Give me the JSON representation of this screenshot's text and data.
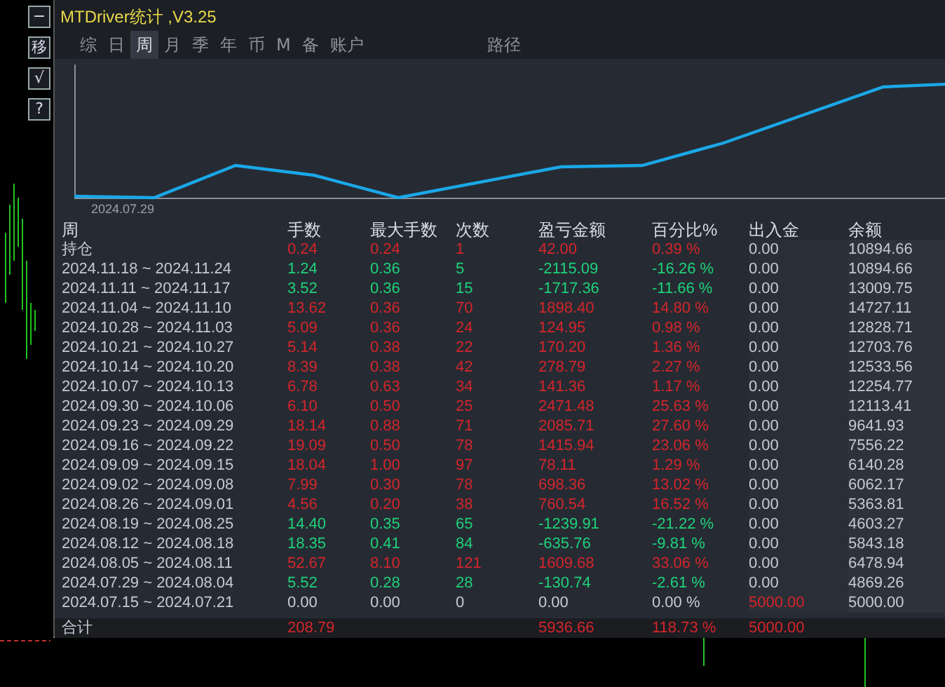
{
  "toolbar": [
    "−",
    "移",
    "√",
    "?"
  ],
  "window": {
    "title": "MTDriver统计 ,V3.25"
  },
  "tabs": [
    {
      "label": "综",
      "selected": false
    },
    {
      "label": "日",
      "selected": false
    },
    {
      "label": "周",
      "selected": true
    },
    {
      "label": "月",
      "selected": false
    },
    {
      "label": "季",
      "selected": false
    },
    {
      "label": "年",
      "selected": false
    },
    {
      "label": "币",
      "selected": false
    },
    {
      "label": "M",
      "selected": false
    },
    {
      "label": "备",
      "selected": false
    },
    {
      "label": "账户",
      "selected": false
    },
    {
      "label": "路径",
      "selected": false
    }
  ],
  "chart": {
    "start_label": "2024.07.29"
  },
  "table": {
    "columns": [
      "周",
      "手数",
      "最大手数",
      "次数",
      "盈亏金额",
      "百分比%",
      "出入金",
      "余额"
    ],
    "rows": [
      {
        "period": "持仓",
        "lots": "0.24",
        "max_lots": "0.24",
        "trades": "1",
        "pnl": "42.00",
        "percent": "0.39 %",
        "deposit": "0.00",
        "balance": "10894.66",
        "kind": "gain",
        "deposit_highlight": false
      },
      {
        "period": "2024.11.18 ~ 2024.11.24",
        "lots": "1.24",
        "max_lots": "0.36",
        "trades": "5",
        "pnl": "-2115.09",
        "percent": "-16.26 %",
        "deposit": "0.00",
        "balance": "10894.66",
        "kind": "loss",
        "deposit_highlight": false
      },
      {
        "period": "2024.11.11 ~ 2024.11.17",
        "lots": "3.52",
        "max_lots": "0.36",
        "trades": "15",
        "pnl": "-1717.36",
        "percent": "-11.66 %",
        "deposit": "0.00",
        "balance": "13009.75",
        "kind": "loss",
        "deposit_highlight": false
      },
      {
        "period": "2024.11.04 ~ 2024.11.10",
        "lots": "13.62",
        "max_lots": "0.36",
        "trades": "70",
        "pnl": "1898.40",
        "percent": "14.80 %",
        "deposit": "0.00",
        "balance": "14727.11",
        "kind": "gain",
        "deposit_highlight": false
      },
      {
        "period": "2024.10.28 ~ 2024.11.03",
        "lots": "5.09",
        "max_lots": "0.36",
        "trades": "24",
        "pnl": "124.95",
        "percent": "0.98 %",
        "deposit": "0.00",
        "balance": "12828.71",
        "kind": "gain",
        "deposit_highlight": false
      },
      {
        "period": "2024.10.21 ~ 2024.10.27",
        "lots": "5.14",
        "max_lots": "0.38",
        "trades": "22",
        "pnl": "170.20",
        "percent": "1.36 %",
        "deposit": "0.00",
        "balance": "12703.76",
        "kind": "gain",
        "deposit_highlight": false
      },
      {
        "period": "2024.10.14 ~ 2024.10.20",
        "lots": "8.39",
        "max_lots": "0.38",
        "trades": "42",
        "pnl": "278.79",
        "percent": "2.27 %",
        "deposit": "0.00",
        "balance": "12533.56",
        "kind": "gain",
        "deposit_highlight": false
      },
      {
        "period": "2024.10.07 ~ 2024.10.13",
        "lots": "6.78",
        "max_lots": "0.63",
        "trades": "34",
        "pnl": "141.36",
        "percent": "1.17 %",
        "deposit": "0.00",
        "balance": "12254.77",
        "kind": "gain",
        "deposit_highlight": false
      },
      {
        "period": "2024.09.30 ~ 2024.10.06",
        "lots": "6.10",
        "max_lots": "0.50",
        "trades": "25",
        "pnl": "2471.48",
        "percent": "25.63 %",
        "deposit": "0.00",
        "balance": "12113.41",
        "kind": "gain",
        "deposit_highlight": false
      },
      {
        "period": "2024.09.23 ~ 2024.09.29",
        "lots": "18.14",
        "max_lots": "0.88",
        "trades": "71",
        "pnl": "2085.71",
        "percent": "27.60 %",
        "deposit": "0.00",
        "balance": "9641.93",
        "kind": "gain",
        "deposit_highlight": false
      },
      {
        "period": "2024.09.16 ~ 2024.09.22",
        "lots": "19.09",
        "max_lots": "0.50",
        "trades": "78",
        "pnl": "1415.94",
        "percent": "23.06 %",
        "deposit": "0.00",
        "balance": "7556.22",
        "kind": "gain",
        "deposit_highlight": false
      },
      {
        "period": "2024.09.09 ~ 2024.09.15",
        "lots": "18.04",
        "max_lots": "1.00",
        "trades": "97",
        "pnl": "78.11",
        "percent": "1.29 %",
        "deposit": "0.00",
        "balance": "6140.28",
        "kind": "gain",
        "deposit_highlight": false
      },
      {
        "period": "2024.09.02 ~ 2024.09.08",
        "lots": "7.99",
        "max_lots": "0.30",
        "trades": "78",
        "pnl": "698.36",
        "percent": "13.02 %",
        "deposit": "0.00",
        "balance": "6062.17",
        "kind": "gain",
        "deposit_highlight": false
      },
      {
        "period": "2024.08.26 ~ 2024.09.01",
        "lots": "4.56",
        "max_lots": "0.20",
        "trades": "38",
        "pnl": "760.54",
        "percent": "16.52 %",
        "deposit": "0.00",
        "balance": "5363.81",
        "kind": "gain",
        "deposit_highlight": false
      },
      {
        "period": "2024.08.19 ~ 2024.08.25",
        "lots": "14.40",
        "max_lots": "0.35",
        "trades": "65",
        "pnl": "-1239.91",
        "percent": "-21.22 %",
        "deposit": "0.00",
        "balance": "4603.27",
        "kind": "loss",
        "deposit_highlight": false
      },
      {
        "period": "2024.08.12 ~ 2024.08.18",
        "lots": "18.35",
        "max_lots": "0.41",
        "trades": "84",
        "pnl": "-635.76",
        "percent": "-9.81 %",
        "deposit": "0.00",
        "balance": "5843.18",
        "kind": "loss",
        "deposit_highlight": false
      },
      {
        "period": "2024.08.05 ~ 2024.08.11",
        "lots": "52.67",
        "max_lots": "8.10",
        "trades": "121",
        "pnl": "1609.68",
        "percent": "33.06 %",
        "deposit": "0.00",
        "balance": "6478.94",
        "kind": "gain",
        "deposit_highlight": false
      },
      {
        "period": "2024.07.29 ~ 2024.08.04",
        "lots": "5.52",
        "max_lots": "0.28",
        "trades": "28",
        "pnl": "-130.74",
        "percent": "-2.61 %",
        "deposit": "0.00",
        "balance": "4869.26",
        "kind": "loss",
        "deposit_highlight": false
      },
      {
        "period": "2024.07.15 ~ 2024.07.21",
        "lots": "0.00",
        "max_lots": "0.00",
        "trades": "0",
        "pnl": "0.00",
        "percent": "0.00 %",
        "deposit": "5000.00",
        "balance": "5000.00",
        "kind": "flat",
        "deposit_highlight": true
      }
    ],
    "total": {
      "label": "合计",
      "lots": "208.79",
      "pnl": "5936.66",
      "percent": "118.73 %",
      "deposit": "5000.00",
      "kind": "gain"
    }
  }
}
